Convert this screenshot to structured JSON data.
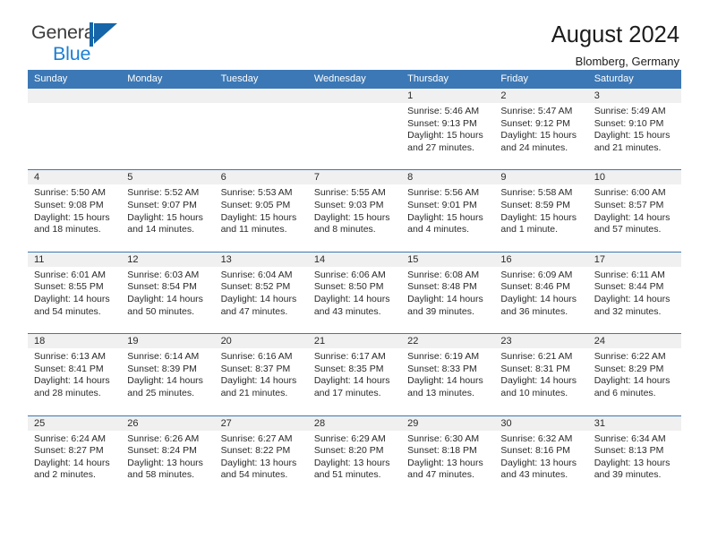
{
  "brand": {
    "name_part1": "General",
    "name_part2": "Blue",
    "flag_color": "#1565a8",
    "blue_text_color": "#1b7fd4"
  },
  "header": {
    "title": "August 2024",
    "subtitle": "Blomberg, Germany",
    "header_bg_color": "#3c78b5",
    "date_band_color": "#f0f0f0"
  },
  "weekdays": [
    "Sunday",
    "Monday",
    "Tuesday",
    "Wednesday",
    "Thursday",
    "Friday",
    "Saturday"
  ],
  "weeks": [
    [
      {
        "day": "",
        "empty": true,
        "sunrise": "",
        "sunset": "",
        "daylight1": "",
        "daylight2": ""
      },
      {
        "day": "",
        "empty": true,
        "sunrise": "",
        "sunset": "",
        "daylight1": "",
        "daylight2": ""
      },
      {
        "day": "",
        "empty": true,
        "sunrise": "",
        "sunset": "",
        "daylight1": "",
        "daylight2": ""
      },
      {
        "day": "",
        "empty": true,
        "sunrise": "",
        "sunset": "",
        "daylight1": "",
        "daylight2": ""
      },
      {
        "day": "1",
        "empty": false,
        "sunrise": "Sunrise: 5:46 AM",
        "sunset": "Sunset: 9:13 PM",
        "daylight1": "Daylight: 15 hours",
        "daylight2": "and 27 minutes."
      },
      {
        "day": "2",
        "empty": false,
        "sunrise": "Sunrise: 5:47 AM",
        "sunset": "Sunset: 9:12 PM",
        "daylight1": "Daylight: 15 hours",
        "daylight2": "and 24 minutes."
      },
      {
        "day": "3",
        "empty": false,
        "sunrise": "Sunrise: 5:49 AM",
        "sunset": "Sunset: 9:10 PM",
        "daylight1": "Daylight: 15 hours",
        "daylight2": "and 21 minutes."
      }
    ],
    [
      {
        "day": "4",
        "empty": false,
        "sunrise": "Sunrise: 5:50 AM",
        "sunset": "Sunset: 9:08 PM",
        "daylight1": "Daylight: 15 hours",
        "daylight2": "and 18 minutes."
      },
      {
        "day": "5",
        "empty": false,
        "sunrise": "Sunrise: 5:52 AM",
        "sunset": "Sunset: 9:07 PM",
        "daylight1": "Daylight: 15 hours",
        "daylight2": "and 14 minutes."
      },
      {
        "day": "6",
        "empty": false,
        "sunrise": "Sunrise: 5:53 AM",
        "sunset": "Sunset: 9:05 PM",
        "daylight1": "Daylight: 15 hours",
        "daylight2": "and 11 minutes."
      },
      {
        "day": "7",
        "empty": false,
        "sunrise": "Sunrise: 5:55 AM",
        "sunset": "Sunset: 9:03 PM",
        "daylight1": "Daylight: 15 hours",
        "daylight2": "and 8 minutes."
      },
      {
        "day": "8",
        "empty": false,
        "sunrise": "Sunrise: 5:56 AM",
        "sunset": "Sunset: 9:01 PM",
        "daylight1": "Daylight: 15 hours",
        "daylight2": "and 4 minutes."
      },
      {
        "day": "9",
        "empty": false,
        "sunrise": "Sunrise: 5:58 AM",
        "sunset": "Sunset: 8:59 PM",
        "daylight1": "Daylight: 15 hours",
        "daylight2": "and 1 minute."
      },
      {
        "day": "10",
        "empty": false,
        "sunrise": "Sunrise: 6:00 AM",
        "sunset": "Sunset: 8:57 PM",
        "daylight1": "Daylight: 14 hours",
        "daylight2": "and 57 minutes."
      }
    ],
    [
      {
        "day": "11",
        "empty": false,
        "sunrise": "Sunrise: 6:01 AM",
        "sunset": "Sunset: 8:55 PM",
        "daylight1": "Daylight: 14 hours",
        "daylight2": "and 54 minutes."
      },
      {
        "day": "12",
        "empty": false,
        "sunrise": "Sunrise: 6:03 AM",
        "sunset": "Sunset: 8:54 PM",
        "daylight1": "Daylight: 14 hours",
        "daylight2": "and 50 minutes."
      },
      {
        "day": "13",
        "empty": false,
        "sunrise": "Sunrise: 6:04 AM",
        "sunset": "Sunset: 8:52 PM",
        "daylight1": "Daylight: 14 hours",
        "daylight2": "and 47 minutes."
      },
      {
        "day": "14",
        "empty": false,
        "sunrise": "Sunrise: 6:06 AM",
        "sunset": "Sunset: 8:50 PM",
        "daylight1": "Daylight: 14 hours",
        "daylight2": "and 43 minutes."
      },
      {
        "day": "15",
        "empty": false,
        "sunrise": "Sunrise: 6:08 AM",
        "sunset": "Sunset: 8:48 PM",
        "daylight1": "Daylight: 14 hours",
        "daylight2": "and 39 minutes."
      },
      {
        "day": "16",
        "empty": false,
        "sunrise": "Sunrise: 6:09 AM",
        "sunset": "Sunset: 8:46 PM",
        "daylight1": "Daylight: 14 hours",
        "daylight2": "and 36 minutes."
      },
      {
        "day": "17",
        "empty": false,
        "sunrise": "Sunrise: 6:11 AM",
        "sunset": "Sunset: 8:44 PM",
        "daylight1": "Daylight: 14 hours",
        "daylight2": "and 32 minutes."
      }
    ],
    [
      {
        "day": "18",
        "empty": false,
        "sunrise": "Sunrise: 6:13 AM",
        "sunset": "Sunset: 8:41 PM",
        "daylight1": "Daylight: 14 hours",
        "daylight2": "and 28 minutes."
      },
      {
        "day": "19",
        "empty": false,
        "sunrise": "Sunrise: 6:14 AM",
        "sunset": "Sunset: 8:39 PM",
        "daylight1": "Daylight: 14 hours",
        "daylight2": "and 25 minutes."
      },
      {
        "day": "20",
        "empty": false,
        "sunrise": "Sunrise: 6:16 AM",
        "sunset": "Sunset: 8:37 PM",
        "daylight1": "Daylight: 14 hours",
        "daylight2": "and 21 minutes."
      },
      {
        "day": "21",
        "empty": false,
        "sunrise": "Sunrise: 6:17 AM",
        "sunset": "Sunset: 8:35 PM",
        "daylight1": "Daylight: 14 hours",
        "daylight2": "and 17 minutes."
      },
      {
        "day": "22",
        "empty": false,
        "sunrise": "Sunrise: 6:19 AM",
        "sunset": "Sunset: 8:33 PM",
        "daylight1": "Daylight: 14 hours",
        "daylight2": "and 13 minutes."
      },
      {
        "day": "23",
        "empty": false,
        "sunrise": "Sunrise: 6:21 AM",
        "sunset": "Sunset: 8:31 PM",
        "daylight1": "Daylight: 14 hours",
        "daylight2": "and 10 minutes."
      },
      {
        "day": "24",
        "empty": false,
        "sunrise": "Sunrise: 6:22 AM",
        "sunset": "Sunset: 8:29 PM",
        "daylight1": "Daylight: 14 hours",
        "daylight2": "and 6 minutes."
      }
    ],
    [
      {
        "day": "25",
        "empty": false,
        "sunrise": "Sunrise: 6:24 AM",
        "sunset": "Sunset: 8:27 PM",
        "daylight1": "Daylight: 14 hours",
        "daylight2": "and 2 minutes."
      },
      {
        "day": "26",
        "empty": false,
        "sunrise": "Sunrise: 6:26 AM",
        "sunset": "Sunset: 8:24 PM",
        "daylight1": "Daylight: 13 hours",
        "daylight2": "and 58 minutes."
      },
      {
        "day": "27",
        "empty": false,
        "sunrise": "Sunrise: 6:27 AM",
        "sunset": "Sunset: 8:22 PM",
        "daylight1": "Daylight: 13 hours",
        "daylight2": "and 54 minutes."
      },
      {
        "day": "28",
        "empty": false,
        "sunrise": "Sunrise: 6:29 AM",
        "sunset": "Sunset: 8:20 PM",
        "daylight1": "Daylight: 13 hours",
        "daylight2": "and 51 minutes."
      },
      {
        "day": "29",
        "empty": false,
        "sunrise": "Sunrise: 6:30 AM",
        "sunset": "Sunset: 8:18 PM",
        "daylight1": "Daylight: 13 hours",
        "daylight2": "and 47 minutes."
      },
      {
        "day": "30",
        "empty": false,
        "sunrise": "Sunrise: 6:32 AM",
        "sunset": "Sunset: 8:16 PM",
        "daylight1": "Daylight: 13 hours",
        "daylight2": "and 43 minutes."
      },
      {
        "day": "31",
        "empty": false,
        "sunrise": "Sunrise: 6:34 AM",
        "sunset": "Sunset: 8:13 PM",
        "daylight1": "Daylight: 13 hours",
        "daylight2": "and 39 minutes."
      }
    ]
  ]
}
